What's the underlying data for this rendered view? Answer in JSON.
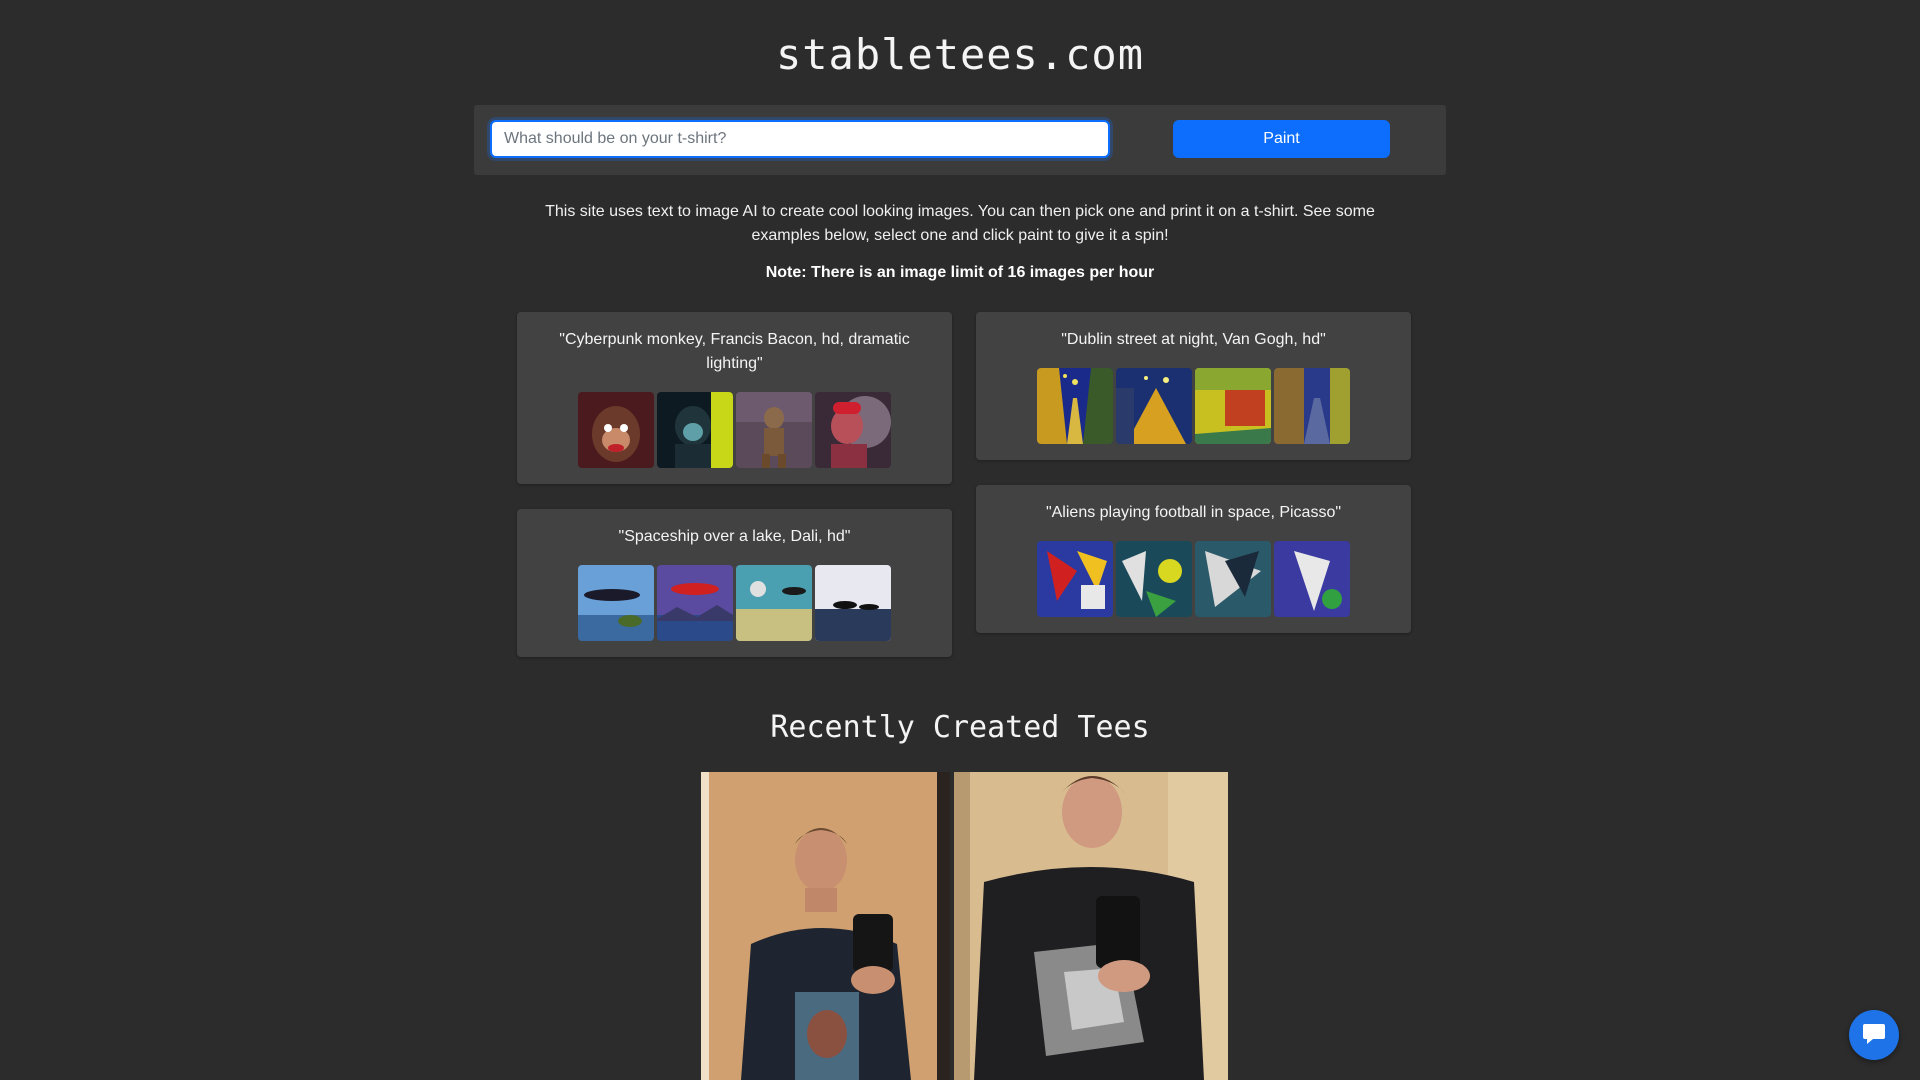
{
  "site": {
    "title": "stabletees.com"
  },
  "search": {
    "placeholder": "What should be on your t-shirt?",
    "value": "",
    "paint_label": "Paint"
  },
  "intro": {
    "text": "This site uses text to image AI to create cool looking images. You can then pick one and print it on a t-shirt. See some examples below, select one and click paint to give it a spin!",
    "note": "Note: There is an image limit of 16 images per hour"
  },
  "examples": [
    {
      "prompt": "\"Cyberpunk monkey, Francis Bacon, hd, dramatic lighting\"",
      "thumbnails": 4
    },
    {
      "prompt": "\"Dublin street at night, Van Gogh, hd\"",
      "thumbnails": 4
    },
    {
      "prompt": "\"Spaceship over a lake, Dali, hd\"",
      "thumbnails": 4
    },
    {
      "prompt": "\"Aliens playing football in space, Picasso\"",
      "thumbnails": 4
    }
  ],
  "recent": {
    "title": "Recently Created Tees"
  },
  "colors": {
    "background": "#2c2c2c",
    "card": "#424242",
    "accent": "#0d6efd"
  },
  "icons": {
    "chat": "chat-bubble-icon"
  }
}
